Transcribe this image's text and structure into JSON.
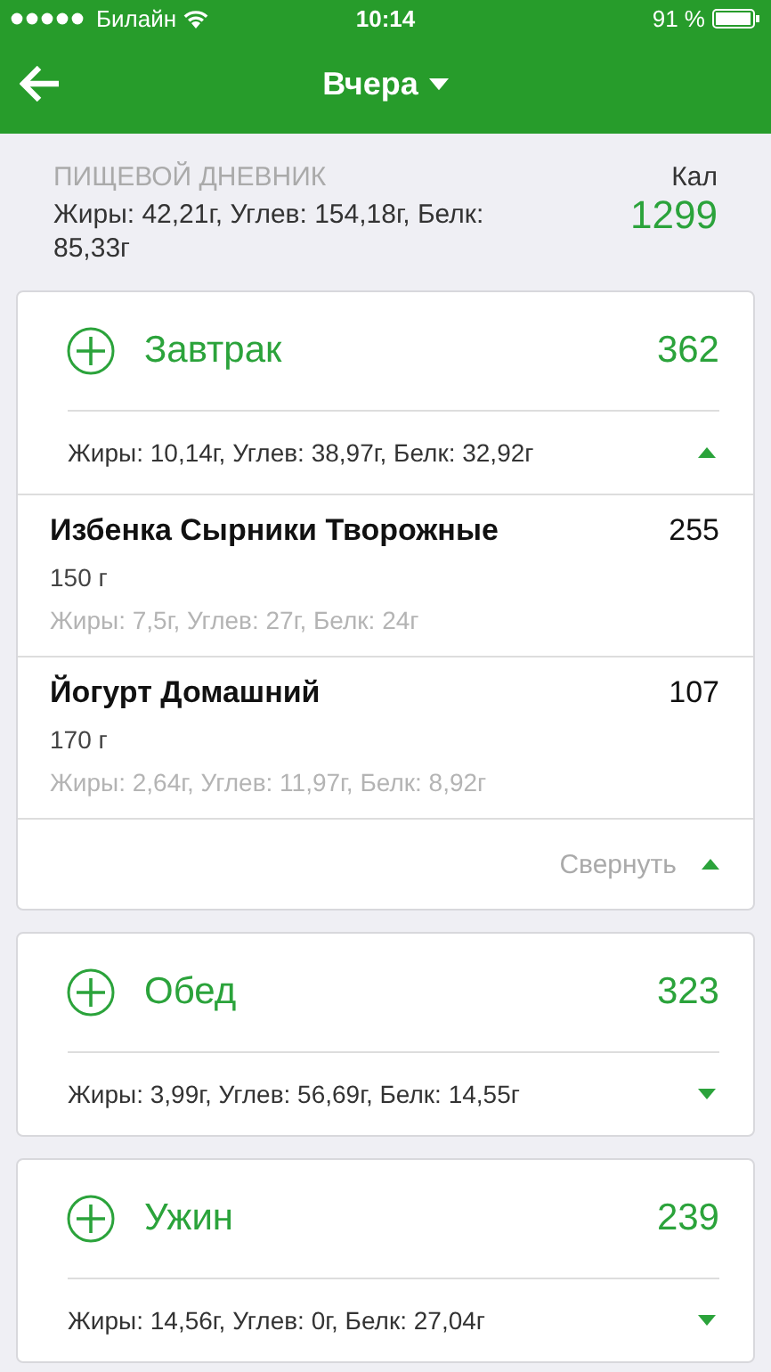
{
  "status_bar": {
    "carrier": "Билайн",
    "time": "10:14",
    "battery": "91 %"
  },
  "nav": {
    "title": "Вчера"
  },
  "summary": {
    "title": "ПИЩЕВОЙ ДНЕВНИК",
    "macros": "Жиры: 42,21г, Углев: 154,18г, Белк: 85,33г",
    "calories_label": "Кал",
    "calories": "1299"
  },
  "meals": [
    {
      "name": "Завтрак",
      "calories": "362",
      "macros": "Жиры: 10,14г, Углев: 38,97г, Белк: 32,92г",
      "expanded": true,
      "items": [
        {
          "name": "Избенка Сырники Творожные",
          "calories": "255",
          "amount": "150 г",
          "macros": "Жиры: 7,5г, Углев: 27г, Белк: 24г"
        },
        {
          "name": "Йогурт Домашний",
          "calories": "107",
          "amount": "170 г",
          "macros": "Жиры: 2,64г, Углев: 11,97г, Белк: 8,92г"
        }
      ],
      "collapse_label": "Свернуть"
    },
    {
      "name": "Обед",
      "calories": "323",
      "macros": "Жиры: 3,99г, Углев: 56,69г, Белк: 14,55г",
      "expanded": false
    },
    {
      "name": "Ужин",
      "calories": "239",
      "macros": "Жиры: 14,56г, Углев: 0г, Белк: 27,04г",
      "expanded": false
    }
  ]
}
